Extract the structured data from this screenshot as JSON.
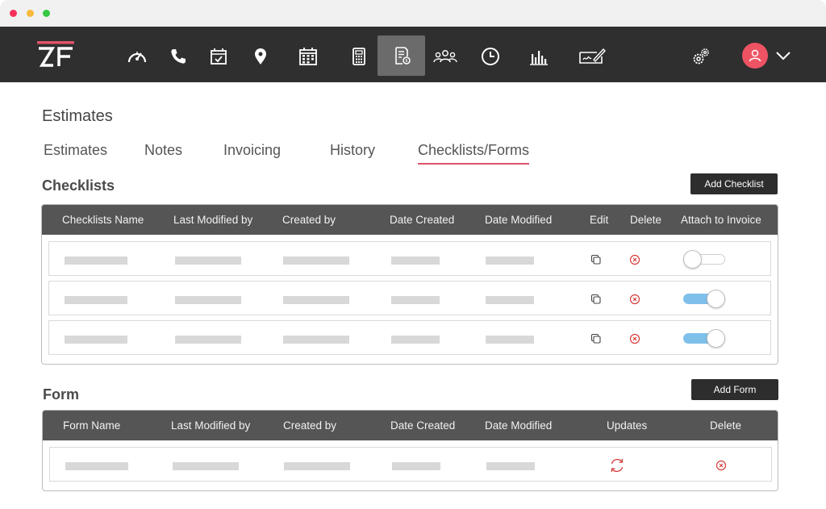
{
  "app": {
    "logo_text": "ZF"
  },
  "colors": {
    "accent": "#e0536a",
    "nav_bg": "#2f2f2f",
    "header_bg": "#555555",
    "toggle_on": "#7ec0ea",
    "delete_red": "#d63b3b"
  },
  "navbar": {
    "icons": [
      "dashboard-gauge-icon",
      "phone-icon",
      "calendar-check-icon",
      "location-pin-icon",
      "calendar-grid-icon",
      "calculator-icon",
      "estimates-document-icon",
      "team-icon",
      "clock-icon",
      "bar-chart-icon",
      "signature-icon",
      "settings-gears-icon"
    ],
    "active": "estimates-document-icon"
  },
  "page": {
    "title": "Estimates"
  },
  "tabs": [
    "Estimates",
    "Notes",
    "Invoicing",
    "History",
    "Checklists/Forms"
  ],
  "active_tab": "Checklists/Forms",
  "checklists": {
    "title": "Checklists",
    "add_label": "Add Checklist",
    "columns": [
      "Checklists Name",
      "Last Modified by",
      "Created by",
      "Date Created",
      "Date Modified",
      "Edit",
      "Delete",
      "Attach to Invoice"
    ],
    "rows": [
      {
        "attach_to_invoice": false
      },
      {
        "attach_to_invoice": true
      },
      {
        "attach_to_invoice": true
      }
    ]
  },
  "forms": {
    "title": "Form",
    "add_label": "Add Form",
    "columns": [
      "Form Name",
      "Last Modified by",
      "Created by",
      "Date Created",
      "Date Modified",
      "Updates",
      "Delete"
    ],
    "rows": [
      {}
    ]
  }
}
